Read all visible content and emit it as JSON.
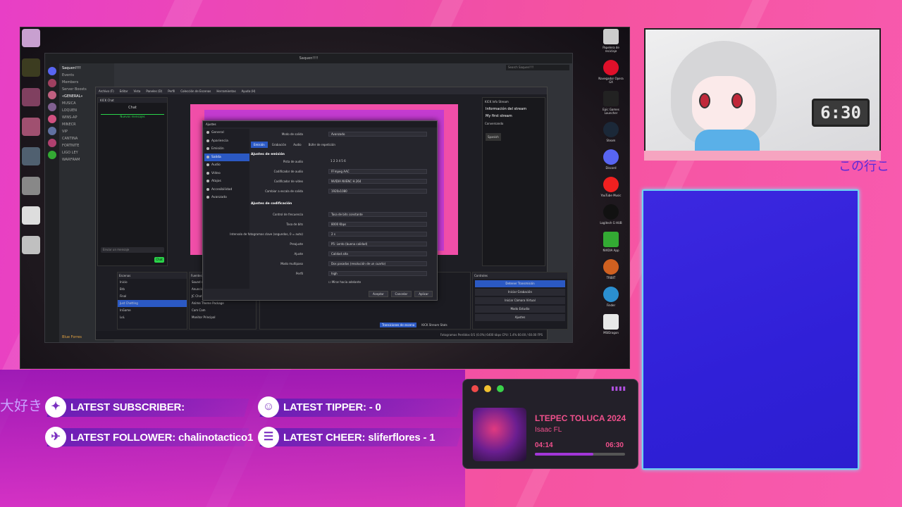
{
  "discord": {
    "title": "Saquen!!!!",
    "server_name": "Saquen!!!!",
    "menu": [
      "Events",
      "Members",
      "Server Boosts"
    ],
    "channels": [
      "«GENERAL»",
      "MUSICA",
      "LOQUEN",
      "WINS-AP",
      "MINECR",
      "VIP",
      "CANTINA",
      "FORTNITE",
      "LIGO LEY",
      "WARFRAM"
    ],
    "user_name": "Blue Forres",
    "search": "Search Saquen!!!!"
  },
  "obs": {
    "menu": [
      "Archivo (F)",
      "Editar",
      "Vista",
      "Paneles (D)",
      "Perfil",
      "Colección de Escenas",
      "Herramientas",
      "Ayuda (H)"
    ],
    "kick_chat": {
      "title": "KICK Chat",
      "header": "Chat",
      "new_messages": "Nuevos mensajes",
      "input_placeholder": "Enviar un mensaje",
      "chat_button": "Chat"
    },
    "kick_info": {
      "title": "KICK Info Stream",
      "header": "Información del stream",
      "stream_title": "My first stream",
      "category": "Conversando",
      "language": "Spanish"
    },
    "scenes": {
      "title": "Escenas",
      "items": [
        "Inicio",
        "Brb",
        "Final",
        "Just Chatting",
        "InGame",
        "LoL"
      ],
      "selected": 3
    },
    "sources": {
      "title": "Fuentes",
      "items": [
        "Sound Alerts",
        "Anuncio Just Chatting",
        "JC Chat",
        "Anime Theme Package",
        "Cam Cam",
        "Monitor Principal"
      ]
    },
    "controls": {
      "title": "Controles",
      "buttons": [
        "Detener Transmisión",
        "Iniciar Grabación",
        "Iniciar Cámara Virtual",
        "Modo Estudio",
        "Ajustes"
      ]
    },
    "bottom_tabs": [
      "Transiciones de escena",
      "KICK Stream Stats"
    ],
    "status": "Fotogramas Perdidos 0/1 (0.0%)   6400 kbps   CPU: 1.4%   60.00 / 60.00 FPS"
  },
  "settings": {
    "title": "Ajustes",
    "nav": [
      "General",
      "Apariencia",
      "Emisión",
      "Salida",
      "Audio",
      "Vídeo",
      "Atajos",
      "Accesibilidad",
      "Avanzado"
    ],
    "nav_selected": 3,
    "output_mode_label": "Modo de salida",
    "output_mode_value": "Avanzado",
    "tabs": [
      "Emisión",
      "Grabación",
      "Audio",
      "Búfer de repetición"
    ],
    "tab_selected": 0,
    "section_audio": "Ajustes de emisión",
    "rows_top": [
      {
        "label": "Pista de audio",
        "value": "1  2  3  4  5  6"
      },
      {
        "label": "Codificador de audio",
        "value": "FFmpeg AAC"
      },
      {
        "label": "Codificador de vídeo",
        "value": "NVIDIA NVENC H.264"
      },
      {
        "label": "Cambiar a escala de salida",
        "value": "1920x1080"
      }
    ],
    "section_encoder": "Ajustes de codificación",
    "rows_encoder": [
      {
        "label": "Control de frecuencia",
        "value": "Tasa de bits constante"
      },
      {
        "label": "Tasa de bits",
        "value": "8000 Kbps"
      },
      {
        "label": "Intervalo de fotogramas clave (segundos, 0 = auto)",
        "value": "2 s"
      },
      {
        "label": "Preajuste",
        "value": "P5: Lento (buena calidad)"
      },
      {
        "label": "Ajuste",
        "value": "Calidad alta"
      },
      {
        "label": "Modo multipaso",
        "value": "Dos pasadas (resolución de un cuarto)"
      },
      {
        "label": "Perfil",
        "value": "high"
      }
    ],
    "checkbox": "Mirar hacia adelante",
    "buttons": [
      "Aceptar",
      "Cancelar",
      "Aplicar"
    ]
  },
  "desktop_right_icons": [
    "Papelera de reciclaje",
    "Navegador Opera GX",
    "Epic Games Launcher",
    "Steam",
    "Discord",
    "YouTube Music",
    "Logitech G HUB",
    "NVIDIA App",
    "TRIBIT",
    "Finder",
    "MSIDragon"
  ],
  "webcam": {
    "clock": "6:30"
  },
  "japanese_right": "この行こ",
  "japanese_left": "大好き",
  "alerts": {
    "subscriber": "LATEST SUBSCRIBER:",
    "tipper": "LATEST TIPPER:  - 0",
    "follower": "LATEST FOLLOWER: chalinotactico1",
    "cheer": "LATEST CHEER: sliferflores - 1"
  },
  "player": {
    "song": "LTEPEC TOLUCA 2024",
    "artist": "Isaac FL",
    "elapsed": "04:14",
    "duration": "06:30",
    "progress": 0.65,
    "dots": [
      "#f04a4a",
      "#f0c030",
      "#3ad24a"
    ]
  }
}
